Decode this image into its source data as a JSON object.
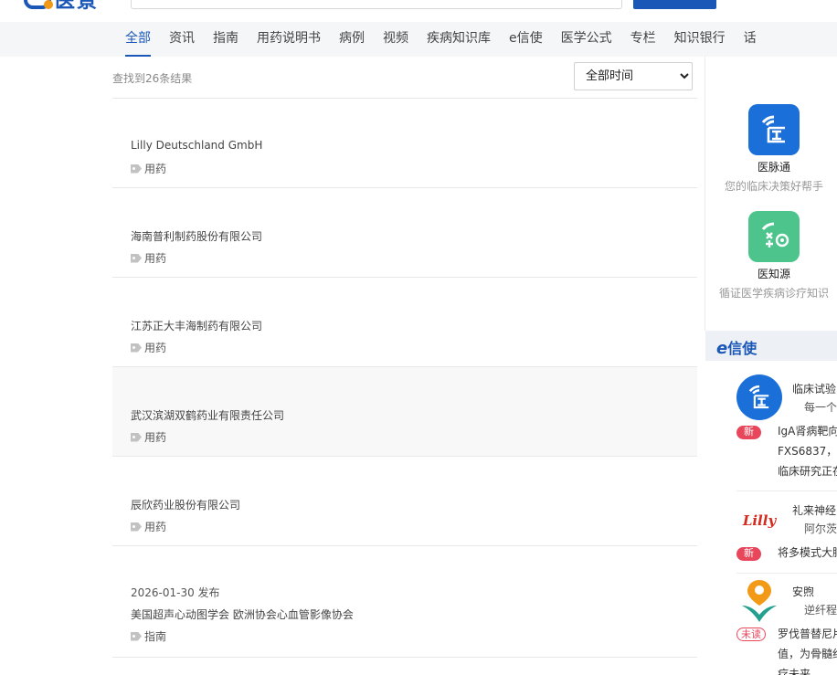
{
  "header": {
    "logo_text": "医景"
  },
  "nav": {
    "items": [
      "全部",
      "资讯",
      "指南",
      "用药说明书",
      "病例",
      "视频",
      "疾病知识库",
      "e信使",
      "医学公式",
      "专栏",
      "知识银行",
      "话"
    ],
    "active_index": 0
  },
  "results": {
    "count_text": "查找到26条结果",
    "time_filter": {
      "selected": "全部时间",
      "options": [
        "全部时间"
      ]
    },
    "items": [
      {
        "date": "",
        "title": "Lilly Deutschland GmbH",
        "tag": "用药"
      },
      {
        "date": "",
        "title": "海南普利制药股份有限公司",
        "tag": "用药"
      },
      {
        "date": "",
        "title": "江苏正大丰海制药有限公司",
        "tag": "用药"
      },
      {
        "date": "",
        "title": "武汉滨湖双鹤药业有限责任公司",
        "tag": "用药"
      },
      {
        "date": "",
        "title": "辰欣药业股份有限公司",
        "tag": "用药"
      },
      {
        "date": "2026-01-30 发布",
        "title": "美国超声心动图学会 欧洲协会心血管影像协会",
        "tag": "指南"
      }
    ]
  },
  "sidebar": {
    "apps": [
      {
        "name": "医脉通",
        "desc": "您的临床决策好帮手",
        "icon": "yimaitong-icon",
        "color": "#1a6fd8"
      },
      {
        "name": "医知源",
        "desc": "循证医学疾病诊疗知识",
        "icon": "yizhiyuan-icon",
        "color": "#4cc48b"
      }
    ],
    "eletter": {
      "title_prefix": "e",
      "title_rest": "信使",
      "messages": [
        {
          "sender": "临床试验",
          "subtitle": "每一个",
          "badge": "新",
          "body": [
            "IgA肾病靶向",
            "FXS6837，这",
            "临床研究正在"
          ]
        },
        {
          "sender": "礼来神经",
          "subtitle": "阿尔茨",
          "badge": "新",
          "body": [
            "将多模式大脑"
          ],
          "logo_text": "Lilly"
        },
        {
          "sender": "安煦",
          "subtitle": "逆纤程",
          "badge": "未读",
          "body": [
            "罗伐普替尼片",
            "值，为骨髓纤",
            "疗未来"
          ]
        }
      ]
    }
  }
}
